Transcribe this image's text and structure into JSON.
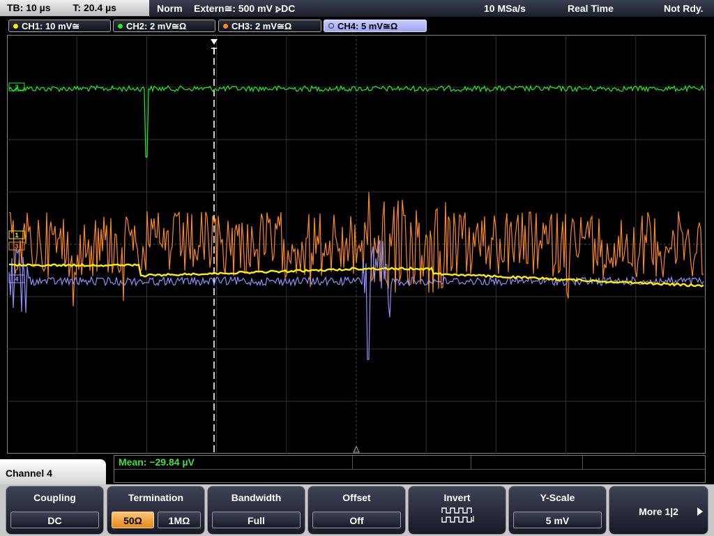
{
  "top": {
    "tb_label": "TB: 10 µs",
    "t_label": "T: 20.4 µs",
    "mode": "Norm",
    "trigger": "Extern≅: 500 mV ⦠DC",
    "sample_rate": "10 MSa/s",
    "acq_mode": "Real Time",
    "status": "Not Rdy."
  },
  "channels": [
    {
      "label": "CH1: 10 mV≅",
      "color": "#ffee00"
    },
    {
      "label": "CH2: 2 mV≅Ω",
      "color": "#22ee22"
    },
    {
      "label": "CH3: 2 mV≅Ω",
      "color": "#ff8a1c"
    },
    {
      "label": "CH4: 5 mV≅Ω",
      "color": "#9b9cff"
    }
  ],
  "measurement": {
    "label": "Mean: −29.84 µV"
  },
  "menu": {
    "title": "Channel 4",
    "coupling": {
      "title": "Coupling",
      "value": "DC"
    },
    "termination": {
      "title": "Termination",
      "opt1": "50Ω",
      "opt2": "1MΩ"
    },
    "bandwidth": {
      "title": "Bandwidth",
      "value": "Full"
    },
    "offset": {
      "title": "Offset",
      "value": "Off"
    },
    "invert": {
      "title": "Invert"
    },
    "yscale": {
      "title": "Y-Scale",
      "value": "5 mV"
    },
    "more": {
      "label": "More 1|2"
    }
  },
  "markers": {
    "trigger_marker": "T",
    "ch1": "1",
    "ch2": "2",
    "ch3": "3",
    "ch4": "4"
  }
}
